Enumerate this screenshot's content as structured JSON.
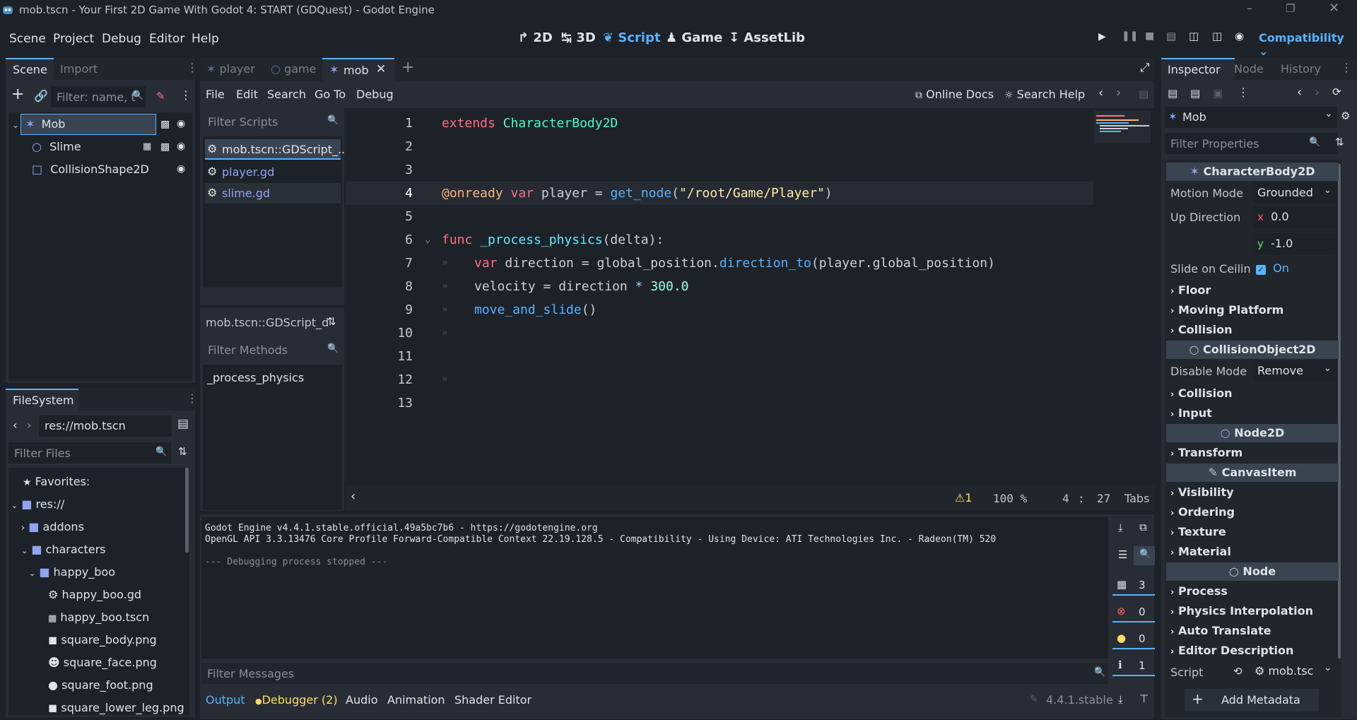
{
  "window": {
    "title": "mob.tscn - Your First 2D Game With Godot 4: START (GDQuest) - Godot Engine"
  },
  "menu": [
    "Scene",
    "Project",
    "Debug",
    "Editor",
    "Help"
  ],
  "workspaces": {
    "d2": "2D",
    "d3": "3D",
    "script": "Script",
    "game": "Game",
    "assetlib": "AssetLib"
  },
  "renderer": "Compatibility",
  "scene_dock": {
    "tabs": [
      "Scene",
      "Import"
    ],
    "filter_placeholder": "Filter: name, t",
    "nodes": [
      {
        "name": "Mob",
        "icon": "characterbody2d-icon"
      },
      {
        "name": "Slime",
        "icon": "node2d-icon"
      },
      {
        "name": "CollisionShape2D",
        "icon": "collisionshape-icon"
      }
    ]
  },
  "filesystem": {
    "tab": "FileSystem",
    "path": "res://mob.tscn",
    "filter_placeholder": "Filter Files",
    "items": [
      {
        "label": "Favorites:",
        "icon": "star-icon"
      },
      {
        "label": "res://",
        "icon": "folder-icon"
      },
      {
        "label": "addons",
        "icon": "folder-icon"
      },
      {
        "label": "characters",
        "icon": "folder-icon"
      },
      {
        "label": "happy_boo",
        "icon": "folder-icon"
      },
      {
        "label": "happy_boo.gd",
        "icon": "gear-icon"
      },
      {
        "label": "happy_boo.tscn",
        "icon": "clapper-icon"
      },
      {
        "label": "square_body.png",
        "icon": "image-icon"
      },
      {
        "label": "square_face.png",
        "icon": "image-icon"
      },
      {
        "label": "square_foot.png",
        "icon": "image-icon"
      },
      {
        "label": "square_lower_leg.png",
        "icon": "image-icon"
      }
    ]
  },
  "scene_tabs": [
    "player",
    "game",
    "mob"
  ],
  "script_menu": [
    "File",
    "Edit",
    "Search",
    "Go To",
    "Debug"
  ],
  "script_toolbar": {
    "online_docs": "Online Docs",
    "search_help": "Search Help"
  },
  "scripts_panel": {
    "filter_placeholder": "Filter Scripts",
    "scripts": [
      "mob.tscn::GDScript_...",
      "player.gd",
      "slime.gd"
    ],
    "current": "mob.tscn::GDScript_d",
    "methods_placeholder": "Filter Methods",
    "methods": [
      "_process_physics"
    ]
  },
  "code": {
    "line_numbers": [
      "1",
      "2",
      "3",
      "4",
      "5",
      "6",
      "7",
      "8",
      "9",
      "10",
      "11",
      "12",
      "13"
    ],
    "l1": {
      "kw": "extends",
      "ty": "CharacterBody2D"
    },
    "l4": {
      "an": "@onready",
      "kw": "var",
      "name": "player",
      "eq": "=",
      "fn": "get_node",
      "p1": "(",
      "str": "\"/root/Game/Player\"",
      "p2": ")"
    },
    "l6": {
      "kw": "func",
      "fn": "_process_physics",
      "sig": "(delta):"
    },
    "l7": {
      "kw": "var",
      "name": "direction",
      "eq": "=",
      "obj": "global_position",
      "dot": ".",
      "fn": "direction_to",
      "args": "(player.global_position)"
    },
    "l8": {
      "name": "velocity",
      "eq": "=",
      "v": "direction",
      "op": "*",
      "num": "300.0"
    },
    "l9": {
      "fn": "move_and_slide",
      "args": "()"
    },
    "tab_marker": "»"
  },
  "status": {
    "warnings": "1",
    "zoom": "100 %",
    "line": "4",
    "col": "27",
    "indent": "Tabs"
  },
  "output": {
    "lines": [
      "Godot Engine v4.4.1.stable.official.49a5bc7b6 - https://godotengine.org",
      "OpenGL API 3.3.13476 Core Profile Forward-Compatible Context 22.19.128.5 - Compatibility - Using Device: ATI Technologies Inc. - Radeon(TM) 520",
      "",
      "--- Debugging process stopped ---"
    ],
    "filter_placeholder": "Filter Messages",
    "counts": {
      "messages": "3",
      "errors": "0",
      "warnings": "0",
      "info": "1"
    }
  },
  "bottom_tabs": [
    "Output",
    "Debugger (2)",
    "Audio",
    "Animation",
    "Shader Editor"
  ],
  "version": "4.4.1.stable",
  "inspector": {
    "tabs": [
      "Inspector",
      "Node",
      "History"
    ],
    "object": "Mob",
    "filter_placeholder": "Filter Properties",
    "cat_characterbody": "CharacterBody2D",
    "motion_mode_label": "Motion Mode",
    "motion_mode": "Grounded",
    "up_dir_label": "Up Direction",
    "up_x_label": "x",
    "up_x": "0.0",
    "up_y_label": "y",
    "up_y": "-1.0",
    "slide_label": "Slide on Ceilin",
    "slide_value": "On",
    "floor": "Floor",
    "moving_platform": "Moving Platform",
    "collision1": "Collision",
    "cat_collisionobject": "CollisionObject2D",
    "disable_mode_label": "Disable Mode",
    "disable_mode": "Remove",
    "collision2": "Collision",
    "input": "Input",
    "cat_node2d": "Node2D",
    "transform": "Transform",
    "cat_canvasitem": "CanvasItem",
    "visibility": "Visibility",
    "ordering": "Ordering",
    "texture": "Texture",
    "material": "Material",
    "cat_node": "Node",
    "process": "Process",
    "physics_interp": "Physics Interpolation",
    "auto_translate": "Auto Translate",
    "editor_desc": "Editor Description",
    "script_label": "Script",
    "script_value": "mob.tsc",
    "add_metadata": "Add Metadata"
  },
  "colors": {
    "accent": "#57b3ff",
    "bg": "#1d2229",
    "panel": "#282d35",
    "keyword": "#ff7085",
    "type": "#42ffc2",
    "function": "#57b3ff",
    "string": "#ffeda1",
    "number": "#a1ffe0",
    "annotation": "#ffb373"
  }
}
